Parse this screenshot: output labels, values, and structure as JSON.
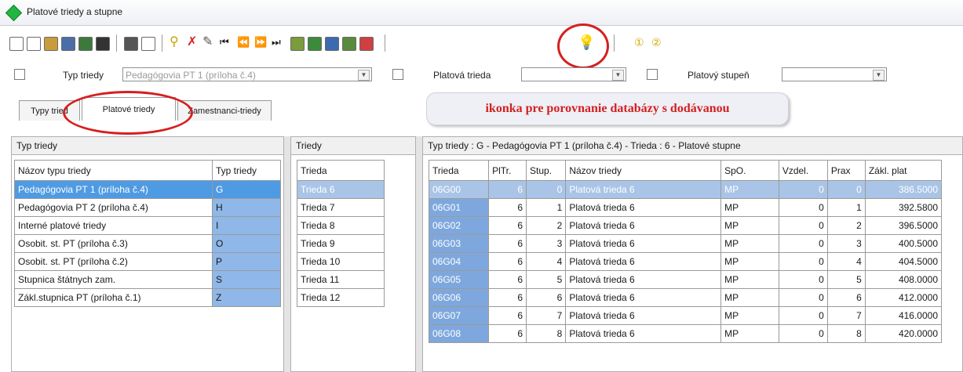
{
  "window": {
    "title": "Platové triedy a stupne"
  },
  "filters": {
    "typ_triedy": {
      "label": "Typ triedy",
      "value": "Pedagógovia PT 1 (príloha č.4)"
    },
    "platova_trieda": {
      "label": "Platová trieda",
      "value": ""
    },
    "platovy_stupen": {
      "label": "Platový stupeň",
      "value": ""
    }
  },
  "tabs": [
    {
      "label": "Typy tried"
    },
    {
      "label": "Platové triedy"
    },
    {
      "label": "Zamestnanci-triedy"
    }
  ],
  "callout": {
    "text": "ikonka pre porovnanie databázy s dodávanou",
    "color": "#d51f1f"
  },
  "typy_panel": {
    "header": "Typ triedy",
    "columns": [
      "Názov typu triedy",
      "Typ triedy"
    ],
    "rows": [
      {
        "nazov": "Pedagógovia PT 1 (príloha č.4)",
        "typ": "G"
      },
      {
        "nazov": "Pedagógovia PT 2 (príloha č.4)",
        "typ": "H"
      },
      {
        "nazov": "Interné platové triedy",
        "typ": "I"
      },
      {
        "nazov": "Osobit. st. PT (príloha č.3)",
        "typ": "O"
      },
      {
        "nazov": "Osobit. st. PT (príloha č.2)",
        "typ": "P"
      },
      {
        "nazov": "Stupnica štátnych zam.",
        "typ": "S"
      },
      {
        "nazov": "Zákl.stupnica PT (príloha č.1)",
        "typ": "Z"
      }
    ]
  },
  "triedy_panel": {
    "header": "Triedy",
    "columns": [
      "Trieda"
    ],
    "rows": [
      "Trieda 6",
      "Trieda 7",
      "Trieda 8",
      "Trieda 9",
      "Trieda 10",
      "Trieda 11",
      "Trieda 12"
    ]
  },
  "stupne_panel": {
    "header": "Typ triedy : G - Pedagógovia PT 1 (príloha č.4) - Trieda : 6 - Platové stupne",
    "columns": [
      "Trieda",
      "PlTr.",
      "Stup.",
      "Názov triedy",
      "SpO.",
      "Vzdel.",
      "Prax",
      "Zákl. plat"
    ],
    "rows": [
      [
        "06G00",
        "6",
        "0",
        "Platová trieda 6",
        "MP",
        "0",
        "0",
        "386.5000"
      ],
      [
        "06G01",
        "6",
        "1",
        "Platová trieda 6",
        "MP",
        "0",
        "1",
        "392.5800"
      ],
      [
        "06G02",
        "6",
        "2",
        "Platová trieda 6",
        "MP",
        "0",
        "2",
        "396.5000"
      ],
      [
        "06G03",
        "6",
        "3",
        "Platová trieda 6",
        "MP",
        "0",
        "3",
        "400.5000"
      ],
      [
        "06G04",
        "6",
        "4",
        "Platová trieda 6",
        "MP",
        "0",
        "4",
        "404.5000"
      ],
      [
        "06G05",
        "6",
        "5",
        "Platová trieda 6",
        "MP",
        "0",
        "5",
        "408.0000"
      ],
      [
        "06G06",
        "6",
        "6",
        "Platová trieda 6",
        "MP",
        "0",
        "6",
        "412.0000"
      ],
      [
        "06G07",
        "6",
        "7",
        "Platová trieda 6",
        "MP",
        "0",
        "7",
        "416.0000"
      ],
      [
        "06G08",
        "6",
        "8",
        "Platová trieda 6",
        "MP",
        "0",
        "8",
        "420.0000"
      ]
    ]
  }
}
